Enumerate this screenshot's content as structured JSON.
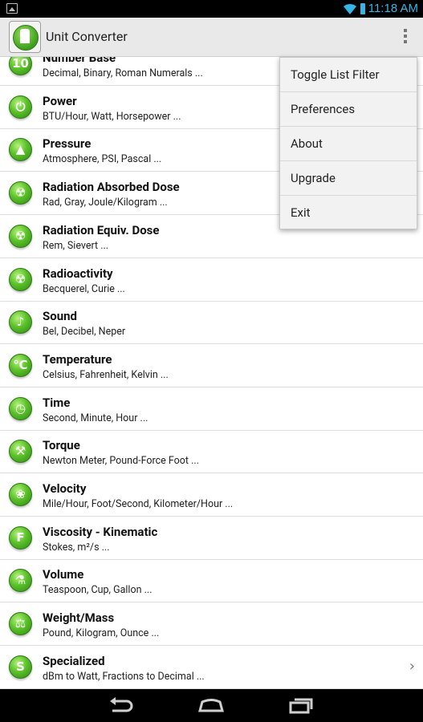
{
  "status_bar": {
    "time": "11:18 AM"
  },
  "app": {
    "title": "Unit Converter"
  },
  "list": [
    {
      "title": "Number Base",
      "subtitle": "Decimal, Binary, Roman Numerals ...",
      "icon": "number-base-icon",
      "glyph": "10"
    },
    {
      "title": "Power",
      "subtitle": "BTU/Hour, Watt, Horsepower ...",
      "icon": "power-plug-icon",
      "glyph": "⏻"
    },
    {
      "title": "Pressure",
      "subtitle": "Atmosphere, PSI, Pascal ...",
      "icon": "pressure-drop-icon",
      "glyph": "▲"
    },
    {
      "title": "Radiation Absorbed Dose",
      "subtitle": "Rad, Gray, Joule/Kilogram ...",
      "icon": "radiation-icon",
      "glyph": "☢"
    },
    {
      "title": "Radiation Equiv. Dose",
      "subtitle": "Rem, Sievert ...",
      "icon": "radiation-icon",
      "glyph": "☢"
    },
    {
      "title": "Radioactivity",
      "subtitle": "Becquerel, Curie ...",
      "icon": "radiation-icon",
      "glyph": "☢"
    },
    {
      "title": "Sound",
      "subtitle": "Bel, Decibel, Neper",
      "icon": "speaker-icon",
      "glyph": "♪"
    },
    {
      "title": "Temperature",
      "subtitle": "Celsius, Fahrenheit, Kelvin ...",
      "icon": "thermometer-icon",
      "glyph": "℃"
    },
    {
      "title": "Time",
      "subtitle": "Second, Minute, Hour ...",
      "icon": "clock-icon",
      "glyph": "◷"
    },
    {
      "title": "Torque",
      "subtitle": "Newton Meter, Pound-Force Foot ...",
      "icon": "wrench-icon",
      "glyph": "⚒"
    },
    {
      "title": "Velocity",
      "subtitle": "Mile/Hour, Foot/Second, Kilometer/Hour ...",
      "icon": "fan-icon",
      "glyph": "❀"
    },
    {
      "title": "Viscosity - Kinematic",
      "subtitle": "Stokes, m²/s ...",
      "icon": "viscosity-icon",
      "glyph": "F"
    },
    {
      "title": "Volume",
      "subtitle": "Teaspoon, Cup, Gallon ...",
      "icon": "flask-icon",
      "glyph": "⚗"
    },
    {
      "title": "Weight/Mass",
      "subtitle": "Pound, Kilogram, Ounce ...",
      "icon": "scale-icon",
      "glyph": "⚖"
    },
    {
      "title": "Specialized",
      "subtitle": "dBm to Watt, Fractions to Decimal ...",
      "icon": "specialized-icon",
      "glyph": "S",
      "has_chevron": true
    }
  ],
  "popup_menu": [
    {
      "label": "Toggle List Filter"
    },
    {
      "label": "Preferences"
    },
    {
      "label": "About"
    },
    {
      "label": "Upgrade"
    },
    {
      "label": "Exit"
    }
  ],
  "colors": {
    "accent": "#33b5e5",
    "icon_green": "#5bc12a",
    "action_bar": "#e9e9e9"
  }
}
